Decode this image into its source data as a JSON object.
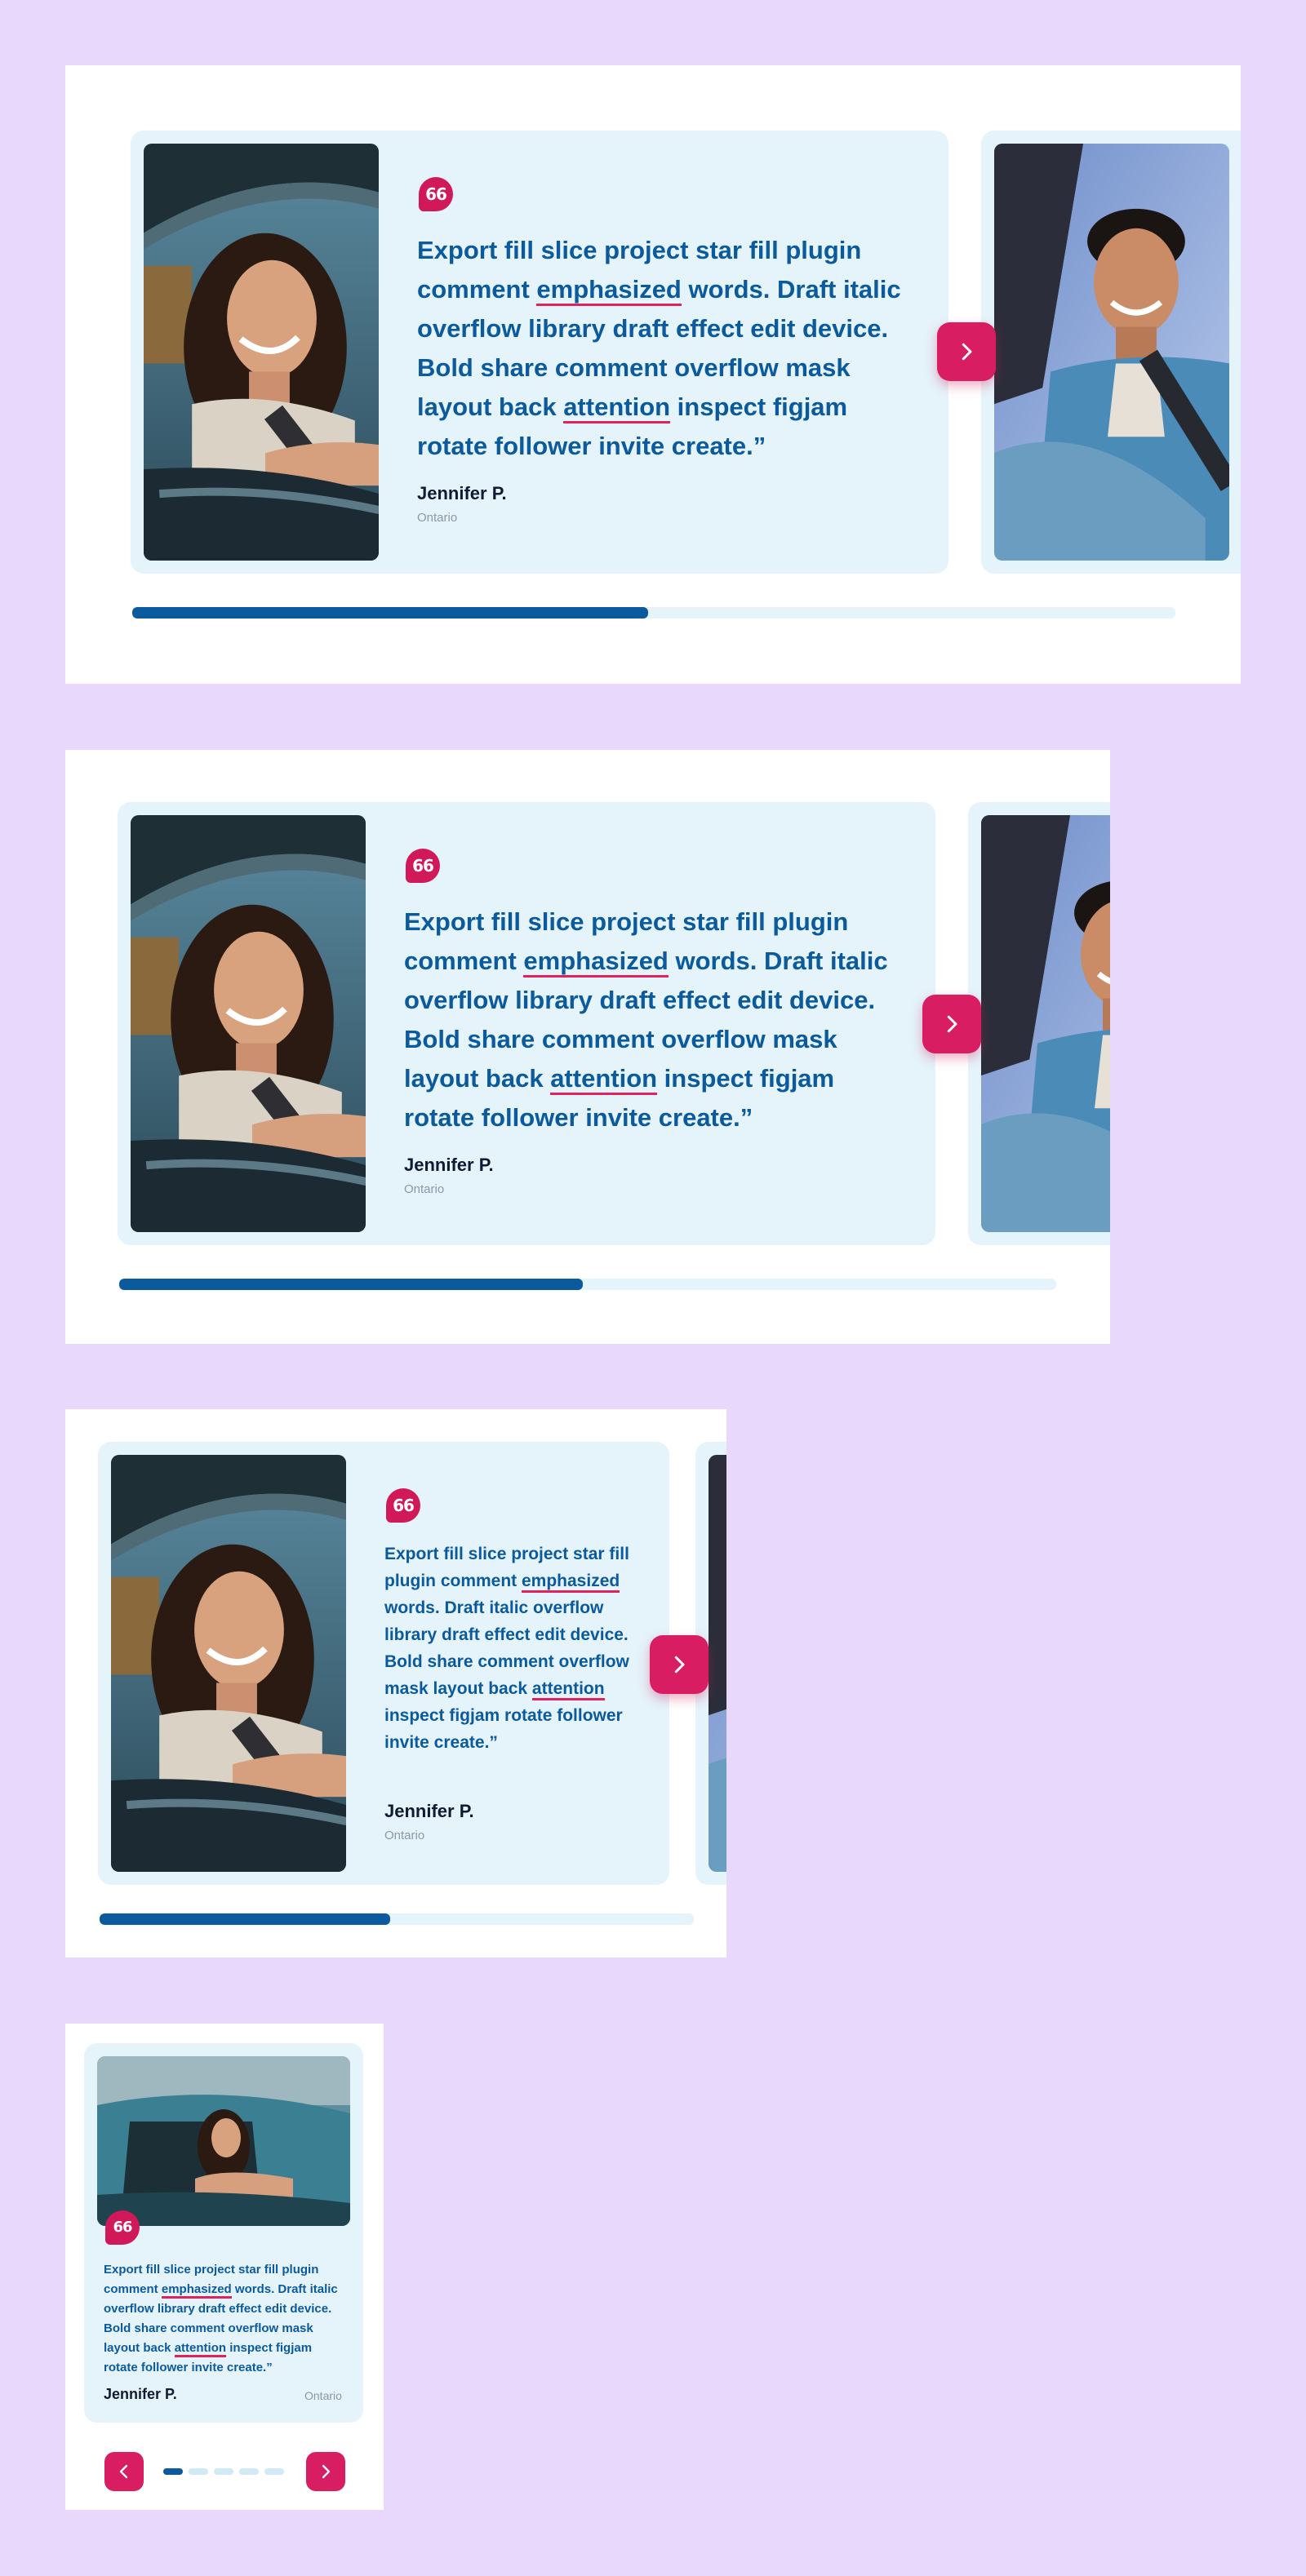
{
  "testimonial": {
    "quote_parts": [
      "Export fill slice project star fill plugin comment ",
      "emphasized",
      " words. Draft italic overflow library draft effect edit device. Bold share comment overflow mask layout back ",
      "attention",
      " inspect figjam rotate follower invite create.”"
    ],
    "author": "Jennifer P.",
    "location": "Ontario",
    "quote_icon_glyph": "66"
  },
  "carousel": {
    "progress_fraction": 0.5,
    "dots_total": 5,
    "active_dot": 1
  },
  "colors": {
    "page_background": "#e8d9fc",
    "card_background": "#e5f3fa",
    "accent": "#d81d63",
    "text_primary": "#0b5a9e",
    "author_text": "#111a33"
  },
  "icons": [
    "quote-icon",
    "chevron-right-icon",
    "chevron-left-icon"
  ]
}
